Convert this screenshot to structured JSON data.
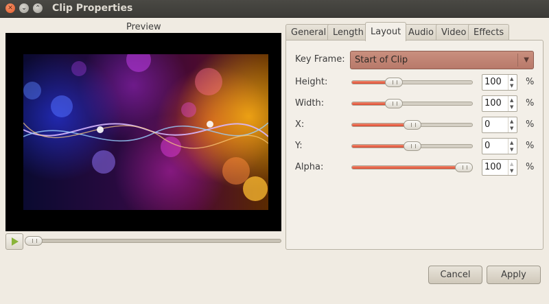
{
  "window": {
    "title": "Clip Properties",
    "close_glyph": "✕",
    "min_glyph": "⌄",
    "max_glyph": "⌃"
  },
  "preview": {
    "label": "Preview"
  },
  "playback": {
    "position": 0.0
  },
  "tabs": [
    {
      "label": "General"
    },
    {
      "label": "Length"
    },
    {
      "label": "Layout",
      "active": true
    },
    {
      "label": "Audio"
    },
    {
      "label": "Video"
    },
    {
      "label": "Effects"
    }
  ],
  "layout": {
    "key_frame_label": "Key Frame:",
    "key_frame_value": "Start of Clip",
    "rows": [
      {
        "label": "Height:",
        "value": "100",
        "unit": "%",
        "slider_fraction": 0.35
      },
      {
        "label": "Width:",
        "value": "100",
        "unit": "%",
        "slider_fraction": 0.35
      },
      {
        "label": "X:",
        "value": "0",
        "unit": "%",
        "slider_fraction": 0.5
      },
      {
        "label": "Y:",
        "value": "0",
        "unit": "%",
        "slider_fraction": 0.5
      },
      {
        "label": "Alpha:",
        "value": "100",
        "unit": "%",
        "slider_fraction": 0.93
      }
    ]
  },
  "buttons": {
    "cancel": "Cancel",
    "apply": "Apply"
  },
  "colors": {
    "slider_fill": "#dd4a30",
    "key_frame_combo": "#c08677",
    "play_icon": "#8ab43a"
  }
}
